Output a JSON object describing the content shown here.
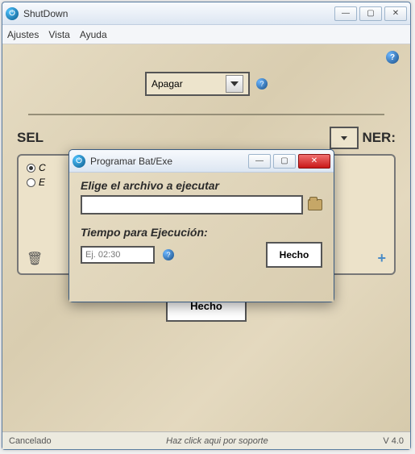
{
  "main": {
    "title": "ShutDown",
    "menu": {
      "settings": "Ajustes",
      "view": "Vista",
      "help": "Ayuda"
    },
    "action_combo": "Apagar",
    "select_label_left": "SEL",
    "select_label_right": "NER:",
    "radio1": "C",
    "radio2": "E",
    "done": "Hecho",
    "status_left": "Cancelado",
    "status_mid": "Haz click aqui por soporte",
    "status_right": "V 4.0"
  },
  "dialog": {
    "title": "Programar Bat/Exe",
    "file_label": "Elige el archivo a ejecutar",
    "file_value": "",
    "time_label": "Tiempo para Ejecución:",
    "time_placeholder": "Ej. 02:30",
    "done": "Hecho"
  }
}
